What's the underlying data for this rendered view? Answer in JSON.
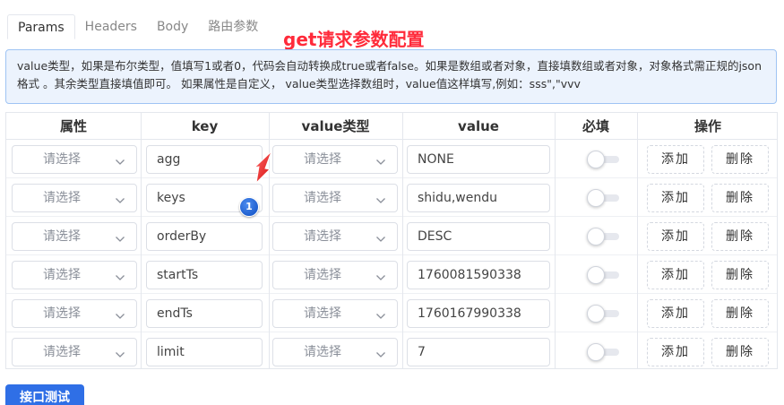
{
  "tabs": [
    {
      "label": "Params",
      "active": true
    },
    {
      "label": "Headers",
      "active": false
    },
    {
      "label": "Body",
      "active": false
    },
    {
      "label": "路由参数",
      "active": false
    }
  ],
  "annotation_text": "get请求参数配置",
  "note_text": "value类型，如果是布尔类型，值填写1或者0，代码会自动转换成true或者false。如果是数组或者对象，直接填数组或者对象，对象格式需正规的json格式 。其余类型直接填值即可。 如果属性是自定义， value类型选择数组时，value值这样填写,例如：sss\",\"vvv",
  "columns": [
    "属性",
    "key",
    "value类型",
    "value",
    "必填",
    "操作"
  ],
  "select_placeholder": "请选择",
  "add_label": "添加",
  "delete_label": "删除",
  "rows": [
    {
      "key": "agg",
      "value": "NONE",
      "required": false
    },
    {
      "key": "keys",
      "value": "shidu,wendu",
      "required": false
    },
    {
      "key": "orderBy",
      "value": "DESC",
      "required": false
    },
    {
      "key": "startTs",
      "value": "1760081590338",
      "required": false
    },
    {
      "key": "endTs",
      "value": "1760167990338",
      "required": false
    },
    {
      "key": "limit",
      "value": "7",
      "required": false
    }
  ],
  "marker_number": "1",
  "test_button_label": "接口测试",
  "colors": {
    "accent": "#2f6fe6",
    "annotation": "#ff2a3a",
    "note_bg": "#ecf3fd",
    "note_border": "#9fc4f4"
  }
}
